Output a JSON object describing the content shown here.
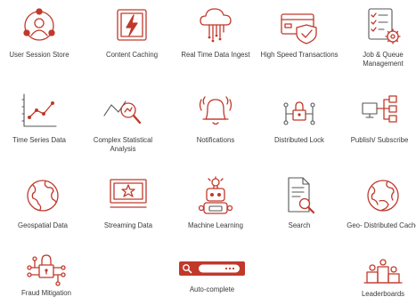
{
  "theme": {
    "accent": "#c0392b",
    "text": "#3a3a3a"
  },
  "tiles": [
    {
      "icon": "user-network-icon",
      "label": "User Session Store"
    },
    {
      "icon": "bolt-box-icon",
      "label": "Content Caching"
    },
    {
      "icon": "cloud-ingest-icon",
      "label": "Real Time Data Ingest"
    },
    {
      "icon": "card-shield-icon",
      "label": "High Speed Transactions"
    },
    {
      "icon": "checklist-gear-icon",
      "label": "Job & Queue Management"
    },
    {
      "icon": "time-series-chart-icon",
      "label": "Time Series Data"
    },
    {
      "icon": "magnify-chart-icon",
      "label": "Complex Statistical Analysis"
    },
    {
      "icon": "bell-icon",
      "label": "Notifications"
    },
    {
      "icon": "network-lock-icon",
      "label": "Distributed Lock"
    },
    {
      "icon": "publish-subscribe-icon",
      "label": "Publish/ Subscribe"
    },
    {
      "icon": "globe-icon",
      "label": "Geospatial Data"
    },
    {
      "icon": "video-star-icon",
      "label": "Streaming Data"
    },
    {
      "icon": "robot-icon",
      "label": "Machine Learning"
    },
    {
      "icon": "search-document-icon",
      "label": "Search"
    },
    {
      "icon": "globe-cache-icon",
      "label": "Geo- Distributed Cache"
    },
    {
      "icon": "circuit-lock-icon",
      "label": "Fraud Mitigation"
    },
    {
      "icon": "autocomplete-search-bar-icon",
      "label": "Auto-complete"
    },
    {
      "icon": "podium-icon",
      "label": "Leaderboards"
    }
  ]
}
